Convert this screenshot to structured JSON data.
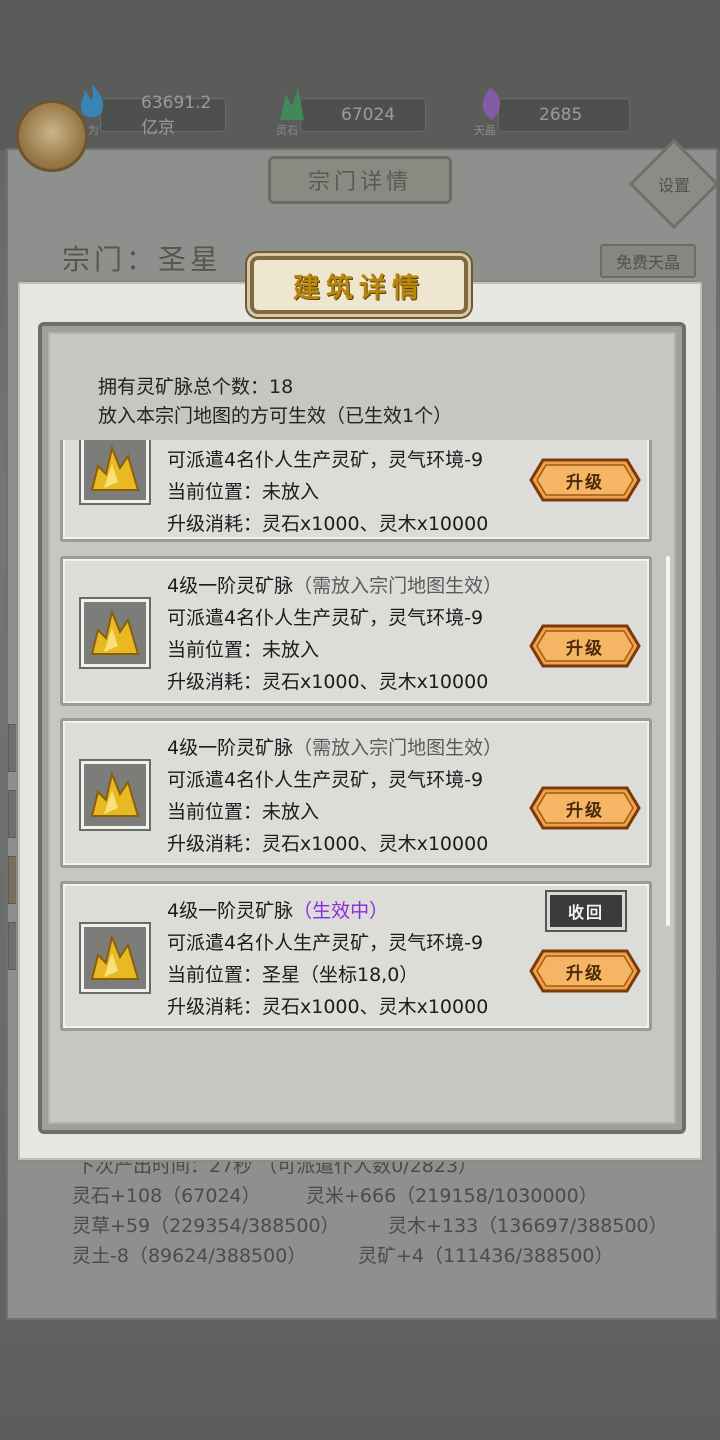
{
  "resources": [
    {
      "label": "为",
      "value": "63691.2亿京",
      "icon": "cultivation-flame-icon",
      "color": "#2a7fb8"
    },
    {
      "label": "灵石",
      "value": "67024",
      "icon": "spirit-stone-icon",
      "color": "#3f8f5a"
    },
    {
      "label": "天晶",
      "value": "2685",
      "icon": "sky-crystal-icon",
      "color": "#8a5ab0"
    }
  ],
  "background": {
    "section_title": "宗门详情",
    "settings_label": "设置",
    "sect_name": "宗门：圣星",
    "free_crystal_label": "免费天晶",
    "footer": {
      "line1": "下次产出时间：27秒 （可派遣仆人数0/2823）",
      "stone": "灵石+108（67024）",
      "rice": "灵米+666（219158/1030000）",
      "herb": "灵草+59（229354/388500）",
      "wood": "灵木+133（136697/388500）",
      "soil": "灵土-8（89624/388500）",
      "ore": "灵矿+4（111436/388500）"
    }
  },
  "dialog": {
    "title": "建筑详情",
    "total_line": "拥有灵矿脉总个数：18",
    "effect_line": "放入本宗门地图的方可生效（已生效1个）"
  },
  "cards": [
    {
      "name": "",
      "note": "",
      "desc": "可派遣4名仆人生产灵矿，灵气环境-9",
      "location": "当前位置：未放入",
      "cost": "升级消耗：灵石x1000、灵木x10000",
      "upgrade": "升级"
    },
    {
      "name": "4级一阶灵矿脉",
      "note": "（需放入宗门地图生效）",
      "desc": "可派遣4名仆人生产灵矿，灵气环境-9",
      "location": "当前位置：未放入",
      "cost": "升级消耗：灵石x1000、灵木x10000",
      "upgrade": "升级"
    },
    {
      "name": "4级一阶灵矿脉",
      "note": "（需放入宗门地图生效）",
      "desc": "可派遣4名仆人生产灵矿，灵气环境-9",
      "location": "当前位置：未放入",
      "cost": "升级消耗：灵石x1000、灵木x10000",
      "upgrade": "升级"
    },
    {
      "name": "4级一阶灵矿脉",
      "note": "（生效中）",
      "desc": "可派遣4名仆人生产灵矿，灵气环境-9",
      "location": "当前位置：圣星（坐标18,0）",
      "cost": "升级消耗：灵石x1000、灵木x10000",
      "upgrade": "升级",
      "recall": "收回"
    }
  ]
}
